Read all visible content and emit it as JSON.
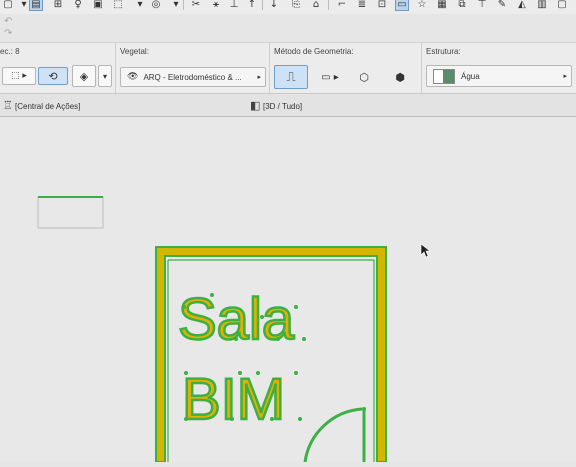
{
  "toolbar": {
    "icons": [
      "select-icon",
      "floor-plan-icon",
      "sun-icon",
      "crop-icon",
      "cube-icon",
      "camera-icon",
      "scissors-icon",
      "magic-wand-icon",
      "measure-icon",
      "arrow-icon",
      "copy-icon",
      "home-icon",
      "flag-icon",
      "list-icon",
      "grid-icon",
      "active-view-icon",
      "star-icon",
      "stack-icon",
      "layers-icon",
      "text-icon",
      "pencil-icon",
      "paint-icon",
      "book-icon"
    ]
  },
  "info_box": {
    "left_panel": {
      "label": "ec.: 8"
    },
    "vegetal": {
      "title": "Vegetal:",
      "value": "ARQ - Eletrodoméstico & ..."
    },
    "geometry": {
      "title": "Método de Geometria:"
    },
    "structure": {
      "title": "Estrutura:",
      "value": "Água"
    }
  },
  "tabs": {
    "left": "[Central de Ações]",
    "center": "[3D / Tudo]"
  },
  "drawing": {
    "text_line1": "Sala",
    "text_line2": "BIM",
    "colors": {
      "outline": "#3cb043",
      "fill": "#f2b705",
      "wall": "#c9b400"
    }
  }
}
